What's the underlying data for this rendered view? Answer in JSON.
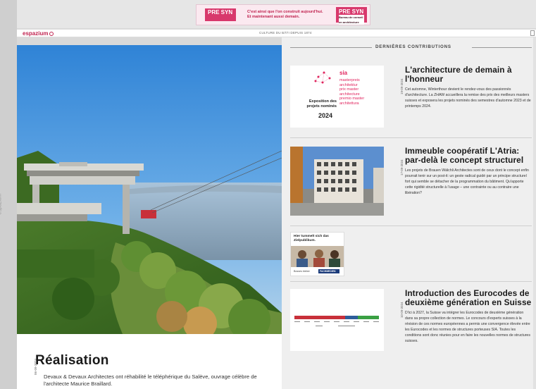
{
  "sidebar": {
    "vertical_label": "espazium"
  },
  "banner": {
    "logo_left": "PRE SYN",
    "tagline_line1": "C'est ainsi que l'on construit aujourd'hui.",
    "tagline_line2": "Et maintenant aussi demain.",
    "logo_right": "PRE SYN",
    "logo_right_sub": "Bureau de conseil en architecture"
  },
  "nav": {
    "brand": "espazium",
    "tagline": "CULTURE DU BÂTI DEPUIS 1874"
  },
  "feature": {
    "title": "Réalisation",
    "date": "06-09-2024",
    "text": "Devaux & Devaux Architectes ont réhabilité le téléphérique du Salève, ouvrage célèbre de l'architecte Maurice Braillard."
  },
  "section": {
    "heading": "DERNIÈRES CONTRIBUTIONS"
  },
  "articles": [
    {
      "date": "19-09-2024",
      "title": "L'architecture de demain à l'honneur",
      "text": "Cet automne, Winterthour devient le rendez-vous des passionnés d'architecture. La ZHAW accueillera la remise des prix des meilleurs masters suisses et exposera les projets nominés des semestres d'automne 2023 et de printemps 2024.",
      "thumb": {
        "sia": "sia",
        "lines": [
          "masterpreis",
          "architektur",
          "prix master",
          "architecture",
          "premio master",
          "architettura"
        ],
        "expo": "Exposition des projets nominés",
        "year": "2024"
      }
    },
    {
      "date": "17-09-2024",
      "title": "Immeuble coopératif L'Atria: par-delà le concept structurel",
      "text": "Les projets de Brauen Wälchli Architectes sont de ceux dont le concept enfin pourrait tenir sur un post-it: un geste radical guidé par un principe structurel fort qui semble se détacher de la programmation du bâtiment. Qu'apporte cette rigidité structurelle à l'usage – une contrainte ou au contraire une libération?"
    },
    {
      "date": "10-09-2024",
      "title": "Introduction des Eurocodes de deuxième génération en Suisse",
      "text": "D'ici à 2027, la Suisse va intégrer les Eurocodes de deuxième génération dans sa propre collection de normes. Le concours d'experts suisses à la révision de ces normes européennes a permis une convergence élevée entre les Eurocodes et les normes de structures porteuses SIA. Toutes les conditions sont donc réunies pour en faire les nouvelles normes de structures suisses."
    }
  ],
  "ad": {
    "title_line1": "Hier tummelt sich das",
    "title_line2": "Zielpublikum.",
    "footer": "Bosses bieber",
    "footer_brand": "FACHMEDIEN"
  },
  "colors": {
    "brand": "#c0224f",
    "sia_red": "#e0245e"
  }
}
